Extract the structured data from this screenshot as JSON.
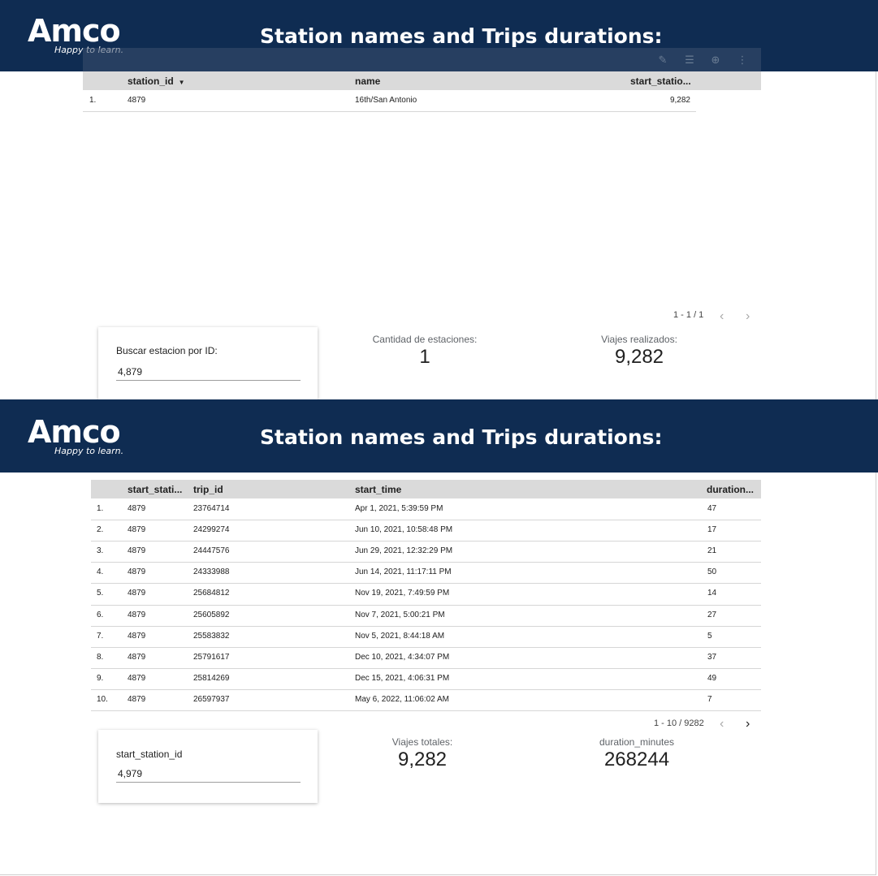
{
  "logo": {
    "name": "Amco",
    "tagline": "Happy to learn."
  },
  "section1": {
    "title": "Station names and Trips durations:",
    "toolbar_icons": [
      "pencil-icon",
      "filter-icon",
      "zoom-icon",
      "more-vert-icon"
    ],
    "table": {
      "columns": [
        "station_id",
        "name",
        "start_statio..."
      ],
      "sort_indicator": "▼",
      "rows": [
        {
          "num": "1.",
          "station_id": "4879",
          "name": "16th/San Antonio",
          "start_station": "9,282"
        }
      ]
    },
    "pager": {
      "text": "1 - 1 / 1",
      "prev": "‹",
      "next": "›"
    },
    "control": {
      "label": "Buscar estacion por ID:",
      "value": "4,879"
    },
    "kpis": [
      {
        "label": "Cantidad de estaciones:",
        "value": "1"
      },
      {
        "label": "Viajes realizados:",
        "value": "9,282"
      }
    ]
  },
  "section2": {
    "title": "Station names and Trips durations:",
    "table": {
      "columns": [
        "start_stati...",
        "trip_id",
        "start_time",
        "duration..."
      ],
      "rows": [
        {
          "num": "1.",
          "start_station": "4879",
          "trip_id": "23764714",
          "start_time": "Apr 1, 2021, 5:39:59 PM",
          "duration": "47"
        },
        {
          "num": "2.",
          "start_station": "4879",
          "trip_id": "24299274",
          "start_time": "Jun 10, 2021, 10:58:48 PM",
          "duration": "17"
        },
        {
          "num": "3.",
          "start_station": "4879",
          "trip_id": "24447576",
          "start_time": "Jun 29, 2021, 12:32:29 PM",
          "duration": "21"
        },
        {
          "num": "4.",
          "start_station": "4879",
          "trip_id": "24333988",
          "start_time": "Jun 14, 2021, 11:17:11 PM",
          "duration": "50"
        },
        {
          "num": "5.",
          "start_station": "4879",
          "trip_id": "25684812",
          "start_time": "Nov 19, 2021, 7:49:59 PM",
          "duration": "14"
        },
        {
          "num": "6.",
          "start_station": "4879",
          "trip_id": "25605892",
          "start_time": "Nov 7, 2021, 5:00:21 PM",
          "duration": "27"
        },
        {
          "num": "7.",
          "start_station": "4879",
          "trip_id": "25583832",
          "start_time": "Nov 5, 2021, 8:44:18 AM",
          "duration": "5"
        },
        {
          "num": "8.",
          "start_station": "4879",
          "trip_id": "25791617",
          "start_time": "Dec 10, 2021, 4:34:07 PM",
          "duration": "37"
        },
        {
          "num": "9.",
          "start_station": "4879",
          "trip_id": "25814269",
          "start_time": "Dec 15, 2021, 4:06:31 PM",
          "duration": "49"
        },
        {
          "num": "10.",
          "start_station": "4879",
          "trip_id": "26597937",
          "start_time": "May 6, 2022, 11:06:02 AM",
          "duration": "7"
        }
      ]
    },
    "pager": {
      "text": "1 - 10 / 9282",
      "prev": "‹",
      "next": "›"
    },
    "control": {
      "label": "start_station_id",
      "value": "4,979"
    },
    "kpis": [
      {
        "label": "Viajes totales:",
        "value": "9,282"
      },
      {
        "label": "duration_minutes",
        "value": "268244"
      }
    ]
  }
}
